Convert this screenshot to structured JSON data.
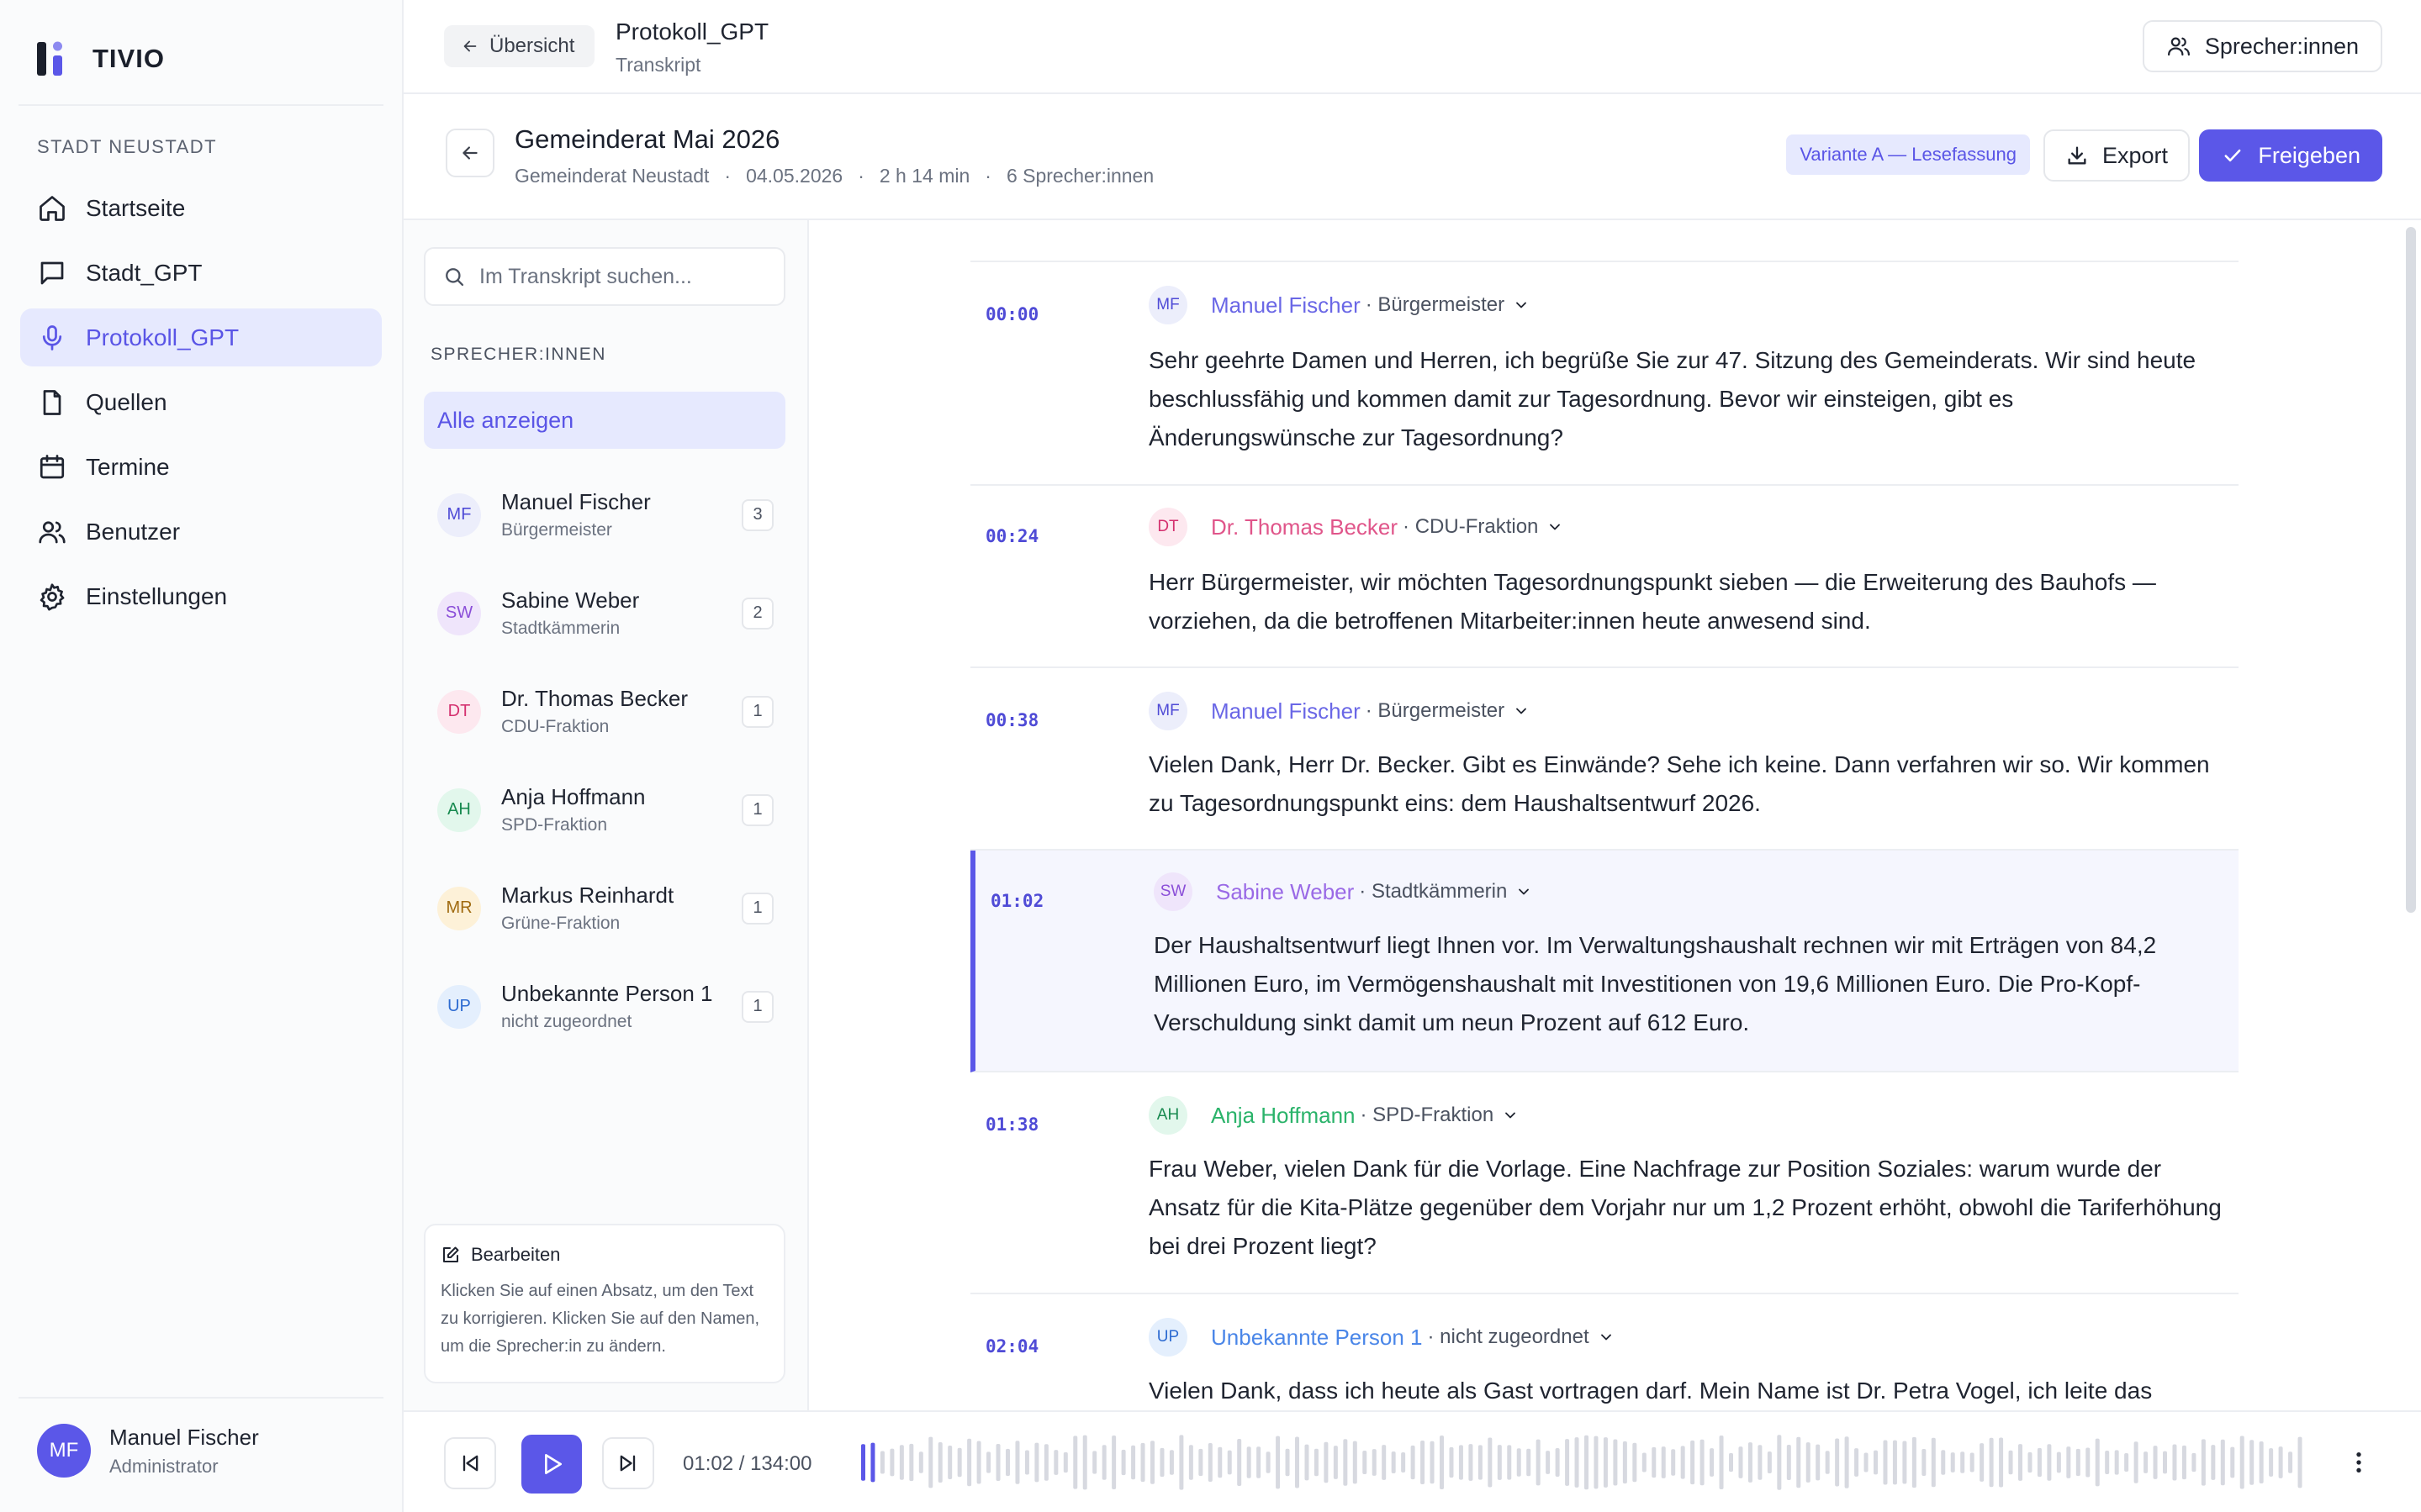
{
  "app": {
    "name": "TIVIO",
    "accent": "#5b57e8"
  },
  "sidebar": {
    "section_label": "STADT NEUSTADT",
    "items": [
      {
        "label": "Startseite",
        "icon": "home-icon"
      },
      {
        "label": "Stadt_GPT",
        "icon": "chat-icon"
      },
      {
        "label": "Protokoll_GPT",
        "icon": "microphone-icon",
        "active": true
      },
      {
        "label": "Quellen",
        "icon": "document-icon"
      },
      {
        "label": "Termine",
        "icon": "calendar-icon"
      },
      {
        "label": "Benutzer",
        "icon": "users-icon"
      },
      {
        "label": "Einstellungen",
        "icon": "gear-icon"
      }
    ],
    "user": {
      "initials": "MF",
      "name": "Manuel Fischer",
      "role": "Administrator"
    }
  },
  "topbar": {
    "back_label": "Übersicht",
    "title": "Protokoll_GPT",
    "subtitle": "Transkript",
    "speakers_label": "Sprecher:innen"
  },
  "meeting": {
    "title": "Gemeinderat Mai 2026",
    "body": "Gemeinderat Neustadt",
    "date": "04.05.2026",
    "duration": "2 h 14 min",
    "speakers": "6 Sprecher:innen",
    "variant": "Variante A — Lesefassung",
    "export_label": "Export",
    "release_label": "Freigeben"
  },
  "left_panel": {
    "search_placeholder": "Im Transkript suchen...",
    "speakers_label": "SPRECHER:INNEN",
    "show_all": "Alle anzeigen",
    "speakers": [
      {
        "initials": "MF",
        "name": "Manuel Fischer",
        "role": "Bürgermeister",
        "count": "3"
      },
      {
        "initials": "SW",
        "name": "Sabine Weber",
        "role": "Stadtkämmerin",
        "count": "2"
      },
      {
        "initials": "DT",
        "name": "Dr. Thomas Becker",
        "role": "CDU-Fraktion",
        "count": "1"
      },
      {
        "initials": "AH",
        "name": "Anja Hoffmann",
        "role": "SPD-Fraktion",
        "count": "1"
      },
      {
        "initials": "MR",
        "name": "Markus Reinhardt",
        "role": "Grüne-Fraktion",
        "count": "1"
      },
      {
        "initials": "UP",
        "name": "Unbekannte Person 1",
        "role": "nicht zugeordnet",
        "count": "1"
      }
    ],
    "edit_title": "Bearbeiten",
    "edit_text": "Klicken Sie auf einen Absatz, um den Text zu korrigieren. Klicken Sie auf den Namen, um die Sprecher:in zu ändern."
  },
  "segments": [
    {
      "time": "00:00",
      "initials": "MF",
      "name": "Manuel Fischer",
      "role": "· Bürgermeister",
      "text": "Sehr geehrte Damen und Herren, ich begrüße Sie zur 47. Sitzung des Gemeinderats. Wir sind heute beschlussfähig und kommen damit zur Tagesordnung. Bevor wir einsteigen, gibt es Änderungswünsche zur Tagesordnung?"
    },
    {
      "time": "00:24",
      "initials": "DT",
      "name": "Dr. Thomas Becker",
      "role": "· CDU-Fraktion",
      "text": "Herr Bürgermeister, wir möchten Tagesordnungspunkt sieben — die Erweiterung des Bauhofs — vorziehen, da die betroffenen Mitarbeiter:innen heute anwesend sind."
    },
    {
      "time": "00:38",
      "initials": "MF",
      "name": "Manuel Fischer",
      "role": "· Bürgermeister",
      "text": "Vielen Dank, Herr Dr. Becker. Gibt es Einwände? Sehe ich keine. Dann verfahren wir so. Wir kommen zu Tagesordnungspunkt eins: dem Haushaltsentwurf 2026."
    },
    {
      "time": "01:02",
      "initials": "SW",
      "name": "Sabine Weber",
      "role": "· Stadtkämmerin",
      "active": true,
      "text": "Der Haushaltsentwurf liegt Ihnen vor. Im Verwaltungshaushalt rechnen wir mit Erträgen von 84,2 Millionen Euro, im Vermögenshaushalt mit Investitionen von 19,6 Millionen Euro. Die Pro-Kopf-Verschuldung sinkt damit um neun Prozent auf 612 Euro."
    },
    {
      "time": "01:38",
      "initials": "AH",
      "name": "Anja Hoffmann",
      "role": "· SPD-Fraktion",
      "text": "Frau Weber, vielen Dank für die Vorlage. Eine Nachfrage zur Position Soziales: warum wurde der Ansatz für die Kita-Plätze gegenüber dem Vorjahr nur um 1,2 Prozent erhöht, obwohl die Tariferhöhung bei drei Prozent liegt?"
    },
    {
      "time": "02:04",
      "initials": "UP",
      "name": "Unbekannte Person 1",
      "role": "· nicht zugeordnet",
      "text": "Vielen Dank, dass ich heute als Gast vortragen darf. Mein Name ist Dr. Petra Vogel, ich leite das"
    }
  ],
  "speaker_colors": {
    "MF": {
      "bg": "#eceefb",
      "fg": "#4f4bd6",
      "name": "#6a67e6"
    },
    "SW": {
      "bg": "#efe5fb",
      "fg": "#8b4fd8",
      "name": "#9a6ae6"
    },
    "DT": {
      "bg": "#fde8ef",
      "fg": "#d4306f",
      "name": "#e0558a"
    },
    "AH": {
      "bg": "#e2f7ec",
      "fg": "#188a50",
      "name": "#2ab36a"
    },
    "MR": {
      "bg": "#fdf1d8",
      "fg": "#a06a10",
      "name": "#c48516"
    },
    "UP": {
      "bg": "#e4effd",
      "fg": "#2d6bd1",
      "name": "#4a86e8"
    }
  },
  "player": {
    "current": "01:02",
    "total": "134:00",
    "time_label": "01:02 / 134:00",
    "progress": 0.0076
  }
}
